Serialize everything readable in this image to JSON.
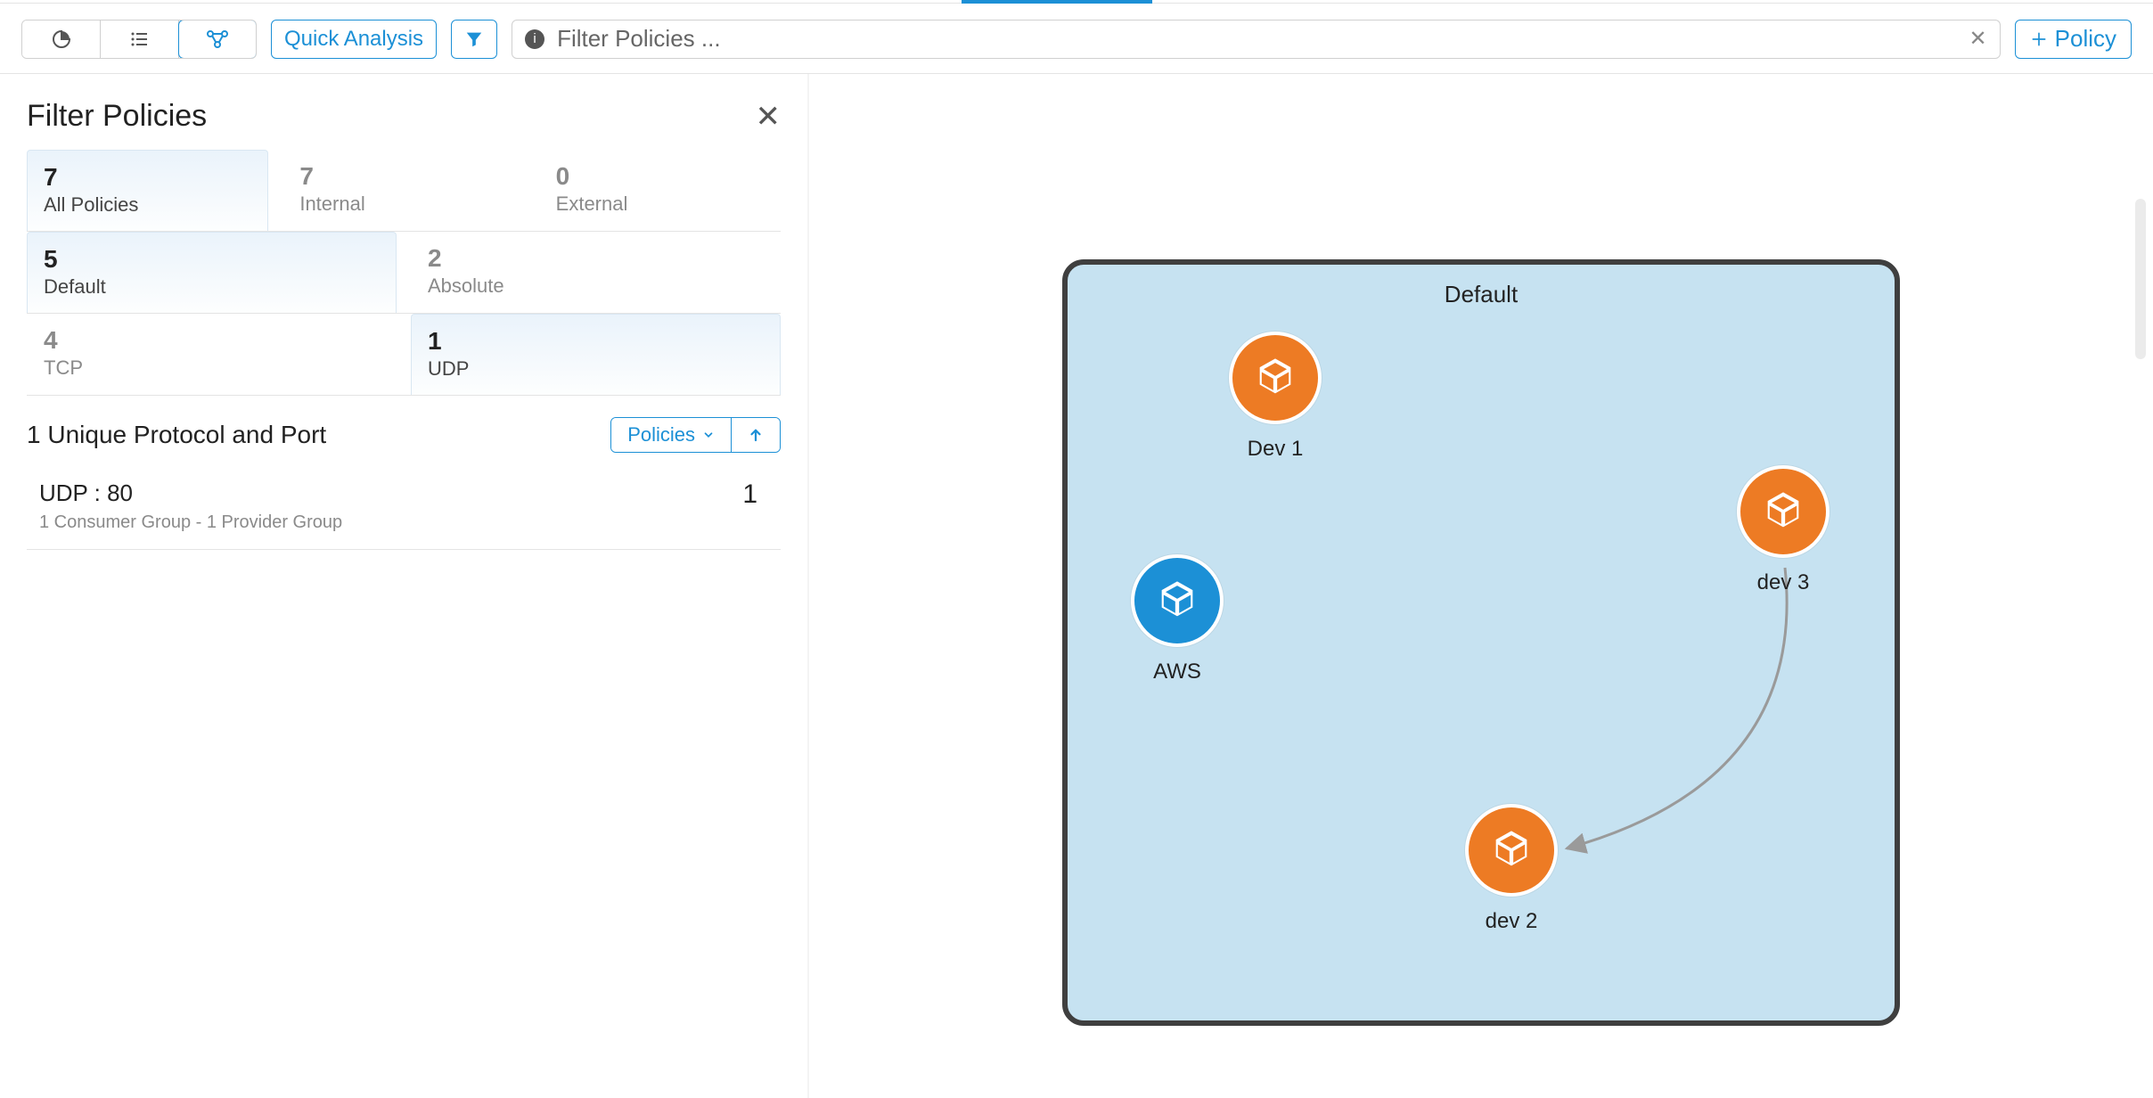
{
  "toolbar": {
    "quick_analysis_label": "Quick Analysis",
    "add_policy_label": "Policy"
  },
  "search": {
    "value": "Filter Policies ..."
  },
  "sidebar": {
    "title": "Filter Policies",
    "facet_rows": [
      [
        {
          "count": "7",
          "label": "All Policies",
          "active": true
        },
        {
          "count": "7",
          "label": "Internal",
          "active": false
        },
        {
          "count": "0",
          "label": "External",
          "active": false
        }
      ],
      [
        {
          "count": "5",
          "label": "Default",
          "active": true
        },
        {
          "count": "2",
          "label": "Absolute",
          "active": false
        }
      ],
      [
        {
          "count": "4",
          "label": "TCP",
          "active": false
        },
        {
          "count": "1",
          "label": "UDP",
          "active": true
        }
      ]
    ],
    "section_title": "1 Unique Protocol and Port",
    "sort_label": "Policies",
    "results": [
      {
        "title": "UDP : 80",
        "sub": "1 Consumer Group - 1 Provider Group",
        "count": "1"
      }
    ]
  },
  "diagram": {
    "title": "Default",
    "nodes": [
      {
        "id": "dev1",
        "label": "Dev 1",
        "color": "orange"
      },
      {
        "id": "aws",
        "label": "AWS",
        "color": "blue"
      },
      {
        "id": "dev3",
        "label": "dev 3",
        "color": "orange"
      },
      {
        "id": "dev2",
        "label": "dev 2",
        "color": "orange"
      }
    ],
    "edges": [
      {
        "from": "dev3",
        "to": "dev2"
      }
    ]
  }
}
